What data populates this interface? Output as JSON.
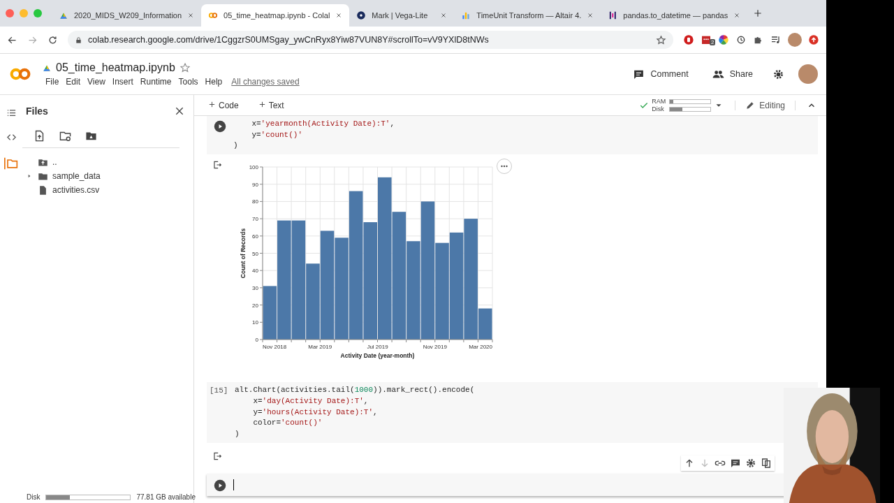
{
  "browser": {
    "tabs": [
      {
        "title": "2020_MIDS_W209_Information",
        "selected": false
      },
      {
        "title": "05_time_heatmap.ipynb - Colal",
        "selected": true
      },
      {
        "title": "Mark | Vega-Lite",
        "selected": false
      },
      {
        "title": "TimeUnit Transform — Altair 4.",
        "selected": false
      },
      {
        "title": "pandas.to_datetime — pandas",
        "selected": false
      }
    ],
    "url": "colab.research.google.com/drive/1CggzrS0UMSgay_ywCnRyx8Yiw87VUN8Y#scrollTo=vV9YXlD8tNWs",
    "extension_badge": "2"
  },
  "notebook": {
    "title": "05_time_heatmap.ipynb",
    "menu": [
      "File",
      "Edit",
      "View",
      "Insert",
      "Runtime",
      "Tools",
      "Help"
    ],
    "save_status": "All changes saved",
    "actions": [
      "Comment",
      "Share"
    ]
  },
  "toolbar": {
    "add_buttons": [
      "Code",
      "Text"
    ],
    "resources": [
      {
        "label": "RAM",
        "level": 0.08
      },
      {
        "label": "Disk",
        "level": 0.3
      }
    ],
    "mode": "Editing"
  },
  "files": {
    "title": "Files",
    "items": [
      {
        "name": "..",
        "kind": "parent"
      },
      {
        "name": "sample_data",
        "kind": "folder"
      },
      {
        "name": "activities.csv",
        "kind": "file"
      }
    ],
    "disk": {
      "label": "Disk",
      "level": 0.28,
      "reading": "77.81 GB available"
    }
  },
  "cells": [
    {
      "focused": false,
      "lines": [
        [
          {
            "text": "    x=",
            "kind": "plain"
          },
          {
            "text": "'yearmonth(Activity Date):T'",
            "kind": "string"
          },
          {
            "text": ",",
            "kind": "plain"
          }
        ],
        [
          {
            "text": "    y=",
            "kind": "plain"
          },
          {
            "text": "'count()'",
            "kind": "string"
          }
        ],
        [
          {
            "text": ")",
            "kind": "plain"
          }
        ]
      ],
      "output": {
        "chart_data": {
          "type": "bar",
          "xlabel": "Activity Date (year-month)",
          "ylabel": "Count of Records",
          "grid": true,
          "categories": [
            "Nov 2018",
            null,
            null,
            null,
            "Mar 2019",
            null,
            null,
            null,
            "Jul 2019",
            null,
            null,
            null,
            "Nov 2019",
            null,
            null,
            "Mar 2020"
          ],
          "values": [
            31,
            69,
            69,
            44,
            63,
            59,
            86,
            68,
            94,
            74,
            57,
            80,
            56,
            62,
            70,
            18
          ],
          "ylim": [
            0,
            100
          ],
          "yticks": [
            0,
            10,
            20,
            30,
            40,
            50,
            60,
            70,
            80,
            90,
            100
          ]
        }
      }
    },
    {
      "focused": false,
      "execution_count": "[15]",
      "lines": [
        [
          {
            "text": "alt.Chart(activities.tail(",
            "kind": "plain"
          },
          {
            "text": "1000",
            "kind": "number"
          },
          {
            "text": ")).mark_rect().encode(",
            "kind": "plain"
          }
        ],
        [
          {
            "text": "    x=",
            "kind": "plain"
          },
          {
            "text": "'day(Activity Date):T'",
            "kind": "string"
          },
          {
            "text": ",",
            "kind": "plain"
          }
        ],
        [
          {
            "text": "    y=",
            "kind": "plain"
          },
          {
            "text": "'hours(Activity Date):T'",
            "kind": "string"
          },
          {
            "text": ",",
            "kind": "plain"
          }
        ],
        [
          {
            "text": "    color=",
            "kind": "plain"
          },
          {
            "text": "'count()'",
            "kind": "string"
          }
        ],
        [
          {
            "text": ")",
            "kind": "plain"
          }
        ]
      ],
      "output": {
        "kind": "empty"
      }
    },
    {
      "focused": true
    }
  ]
}
